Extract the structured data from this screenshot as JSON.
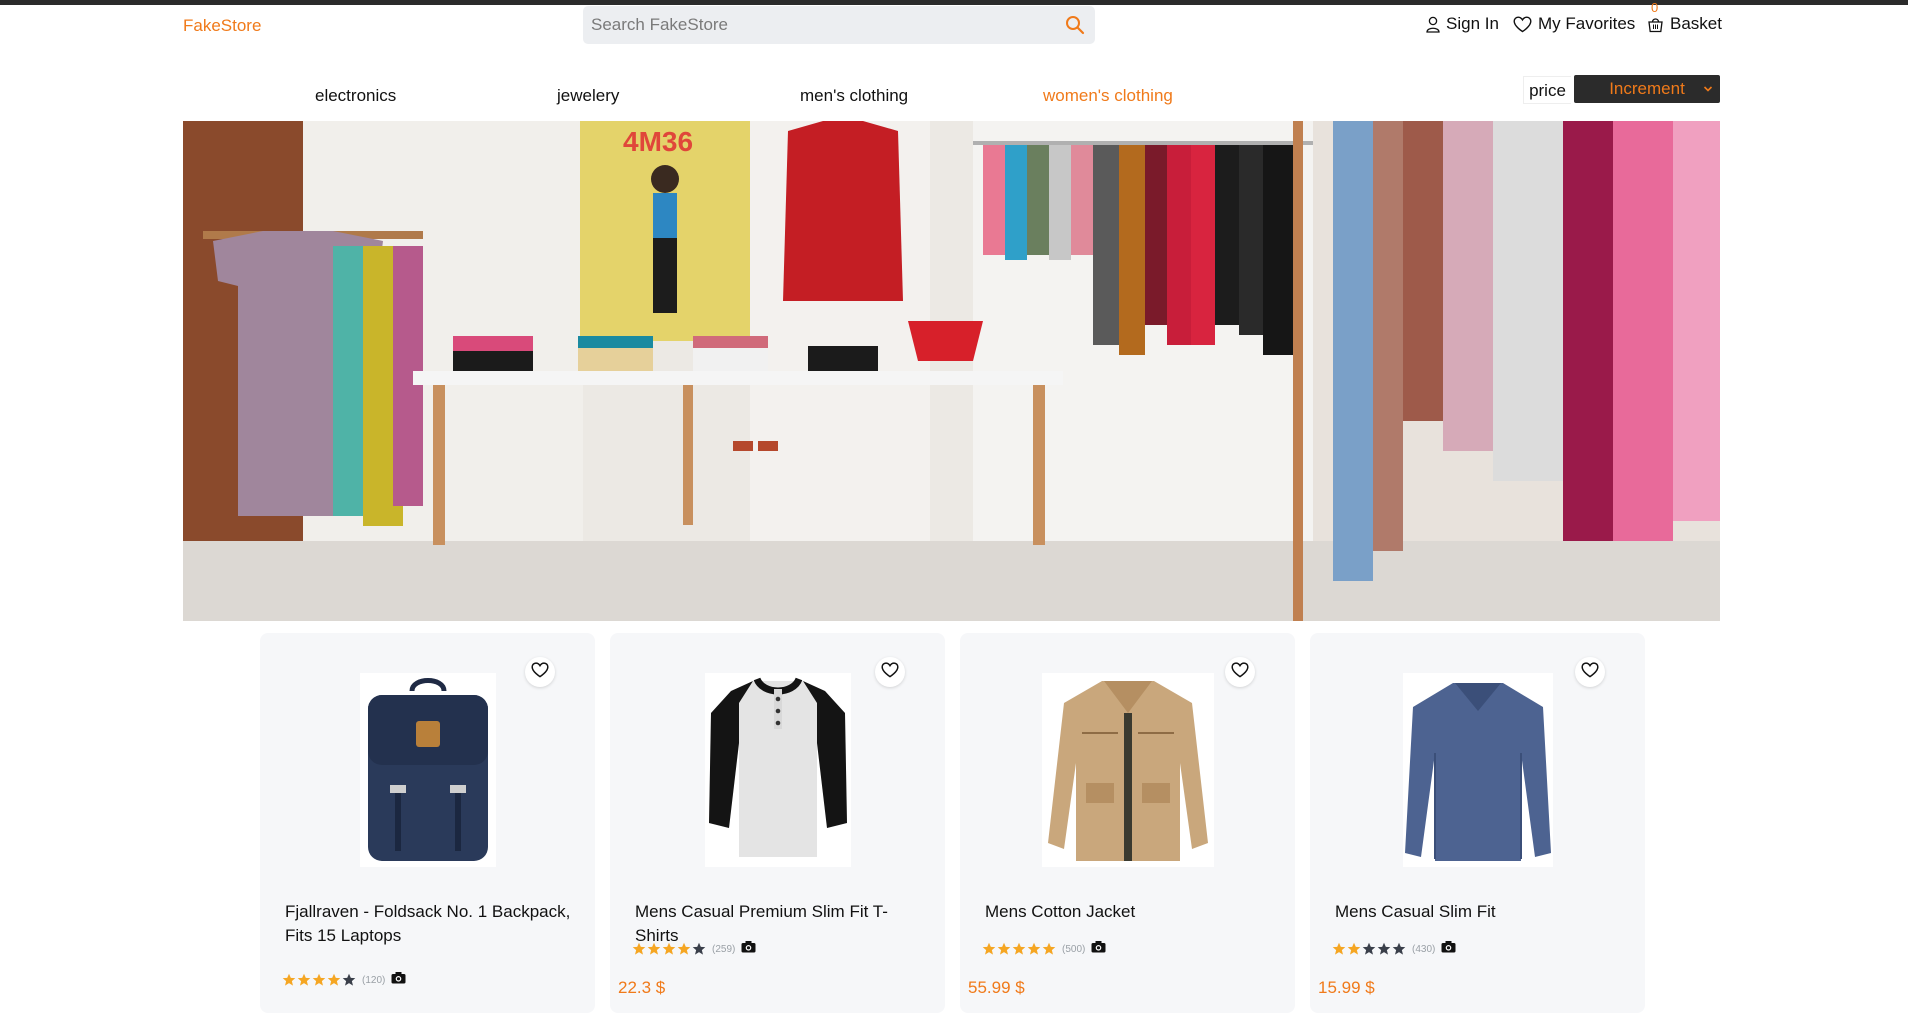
{
  "header": {
    "logo": "FakeStore",
    "search_placeholder": "Search FakeStore",
    "sign_in": "Sign In",
    "favorites": "My Favorites",
    "basket": "Basket",
    "basket_count": "0"
  },
  "nav": {
    "categories": [
      "electronics",
      "jewelery",
      "men's clothing",
      "women's clothing"
    ],
    "active_category": "women's clothing",
    "price_label": "price",
    "sort_value": "Increment"
  },
  "colors": {
    "accent": "#f07a1a",
    "dark": "#2b2b2b",
    "star": "#f5a623"
  },
  "products": [
    {
      "title": "Fjallraven - Foldsack No. 1 Backpack, Fits 15 Laptops",
      "rating": 4,
      "count": "(120)",
      "price": ""
    },
    {
      "title": "Mens Casual Premium Slim Fit T-Shirts",
      "rating": 4,
      "count": "(259)",
      "price": "22.3 $"
    },
    {
      "title": "Mens Cotton Jacket",
      "rating": 5,
      "count": "(500)",
      "price": "55.99 $"
    },
    {
      "title": "Mens Casual Slim Fit",
      "rating": 2,
      "count": "(430)",
      "price": "15.99 $"
    }
  ]
}
